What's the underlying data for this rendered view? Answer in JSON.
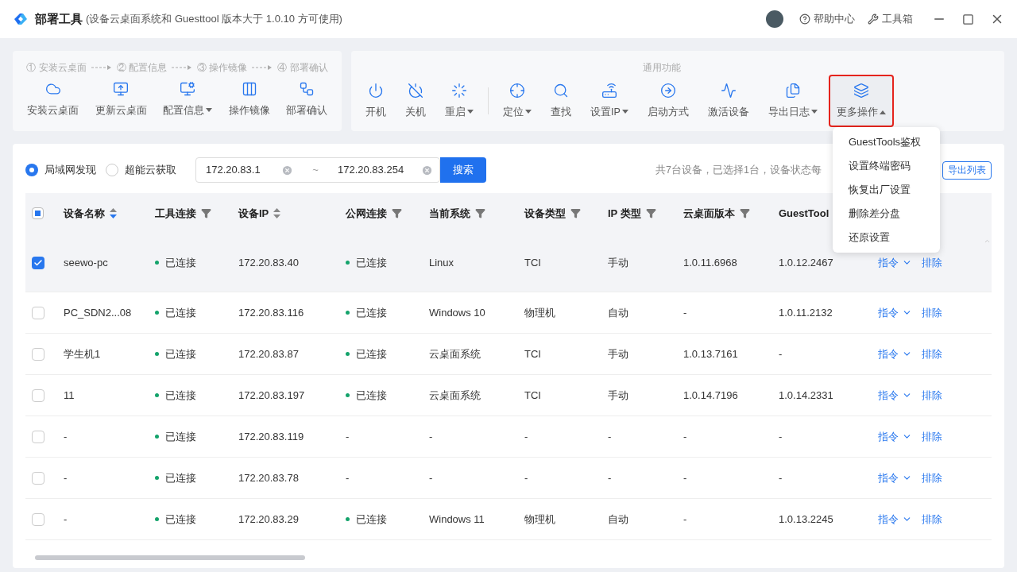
{
  "window": {
    "title": "部署工具",
    "subtitle": "(设备云桌面系统和 Guesttool 版本大于 1.0.10 方可使用)",
    "links": [
      "帮助中心",
      "工具箱"
    ]
  },
  "workflow": {
    "steps": [
      "① 安装云桌面",
      "② 配置信息",
      "③ 操作镜像",
      "④ 部署确认"
    ],
    "buttons": [
      {
        "label": "安装云桌面",
        "dropdown": false
      },
      {
        "label": "更新云桌面",
        "dropdown": false
      },
      {
        "label": "配置信息",
        "dropdown": true
      },
      {
        "label": "操作镜像",
        "dropdown": false
      },
      {
        "label": "部署确认",
        "dropdown": false
      }
    ]
  },
  "general": {
    "title": "通用功能",
    "groups": [
      [
        {
          "label": "开机",
          "dropdown": false
        },
        {
          "label": "关机",
          "dropdown": false
        },
        {
          "label": "重启",
          "dropdown": true,
          "expanded": false,
          "highlighted": false
        }
      ],
      [
        {
          "label": "定位",
          "dropdown": true,
          "expanded": false,
          "highlighted": false
        },
        {
          "label": "查找",
          "dropdown": false
        },
        {
          "label": "设置IP",
          "dropdown": true,
          "expanded": false,
          "highlighted": false
        },
        {
          "label": "启动方式",
          "dropdown": false
        },
        {
          "label": "激活设备",
          "dropdown": false
        },
        {
          "label": "导出日志",
          "dropdown": true,
          "expanded": false,
          "highlighted": false
        },
        {
          "label": "更多操作",
          "dropdown": true,
          "expanded": true,
          "highlighted": true
        }
      ]
    ]
  },
  "menu": {
    "items": [
      "GuestTools鉴权",
      "设置终端密码",
      "恢复出厂设置",
      "删除差分盘",
      "还原设置"
    ]
  },
  "discovery": {
    "modes": [
      {
        "label": "局域网发现",
        "selected": true
      },
      {
        "label": "超能云获取",
        "selected": false
      }
    ],
    "ip_from": "172.20.83.1",
    "separator": "~",
    "ip_to": "172.20.83.254",
    "search_button": "搜索",
    "summary": "共7台设备，已选择1台，设备状态每",
    "export_button": "导出列表"
  },
  "table": {
    "select_all_indeterminate": true,
    "columns": [
      {
        "label": "设备名称",
        "kind": "sort",
        "sorted_descending": true
      },
      {
        "label": "工具连接",
        "kind": "filter"
      },
      {
        "label": "设备IP",
        "kind": "sort",
        "sorted_descending": false
      },
      {
        "label": "公网连接",
        "kind": "filter"
      },
      {
        "label": "当前系统",
        "kind": "filter"
      },
      {
        "label": "设备类型",
        "kind": "filter"
      },
      {
        "label": "IP 类型",
        "kind": "filter"
      },
      {
        "label": "云桌面版本",
        "kind": "filter"
      },
      {
        "label": "GuestTool",
        "kind": "plain"
      }
    ],
    "rows": [
      {
        "checked": true,
        "cells": [
          {
            "text": "seewo-pc",
            "connected": false
          },
          {
            "text": "已连接",
            "connected": true
          },
          {
            "text": "172.20.83.40",
            "connected": false
          },
          {
            "text": "已连接",
            "connected": true
          },
          {
            "text": "Linux",
            "connected": false
          },
          {
            "text": "TCI",
            "connected": false
          },
          {
            "text": "手动",
            "connected": false
          },
          {
            "text": "1.0.11.6968",
            "connected": false
          },
          {
            "text": "1.0.12.2467",
            "connected": false
          }
        ],
        "actions": [
          "指令",
          "排除"
        ]
      },
      {
        "checked": false,
        "cells": [
          {
            "text": "PC_SDN2...08",
            "connected": false
          },
          {
            "text": "已连接",
            "connected": true
          },
          {
            "text": "172.20.83.116",
            "connected": false
          },
          {
            "text": "已连接",
            "connected": true
          },
          {
            "text": "Windows 10",
            "connected": false
          },
          {
            "text": "物理机",
            "connected": false
          },
          {
            "text": "自动",
            "connected": false
          },
          {
            "text": "-",
            "connected": false
          },
          {
            "text": "1.0.11.2132",
            "connected": false
          }
        ],
        "actions": [
          "指令",
          "排除"
        ]
      },
      {
        "checked": false,
        "cells": [
          {
            "text": "学生机1",
            "connected": false
          },
          {
            "text": "已连接",
            "connected": true
          },
          {
            "text": "172.20.83.87",
            "connected": false
          },
          {
            "text": "已连接",
            "connected": true
          },
          {
            "text": "云桌面系统",
            "connected": false
          },
          {
            "text": "TCI",
            "connected": false
          },
          {
            "text": "手动",
            "connected": false
          },
          {
            "text": "1.0.13.7161",
            "connected": false
          },
          {
            "text": "-",
            "connected": false
          }
        ],
        "actions": [
          "指令",
          "排除"
        ]
      },
      {
        "checked": false,
        "cells": [
          {
            "text": "11",
            "connected": false
          },
          {
            "text": "已连接",
            "connected": true
          },
          {
            "text": "172.20.83.197",
            "connected": false
          },
          {
            "text": "已连接",
            "connected": true
          },
          {
            "text": "云桌面系统",
            "connected": false
          },
          {
            "text": "TCI",
            "connected": false
          },
          {
            "text": "手动",
            "connected": false
          },
          {
            "text": "1.0.14.7196",
            "connected": false
          },
          {
            "text": "1.0.14.2331",
            "connected": false
          }
        ],
        "actions": [
          "指令",
          "排除"
        ]
      },
      {
        "checked": false,
        "cells": [
          {
            "text": "-",
            "connected": false
          },
          {
            "text": "已连接",
            "connected": true
          },
          {
            "text": "172.20.83.119",
            "connected": false
          },
          {
            "text": "-",
            "connected": false
          },
          {
            "text": "-",
            "connected": false
          },
          {
            "text": "-",
            "connected": false
          },
          {
            "text": "-",
            "connected": false
          },
          {
            "text": "-",
            "connected": false
          },
          {
            "text": "-",
            "connected": false
          }
        ],
        "actions": [
          "指令",
          "排除"
        ]
      },
      {
        "checked": false,
        "cells": [
          {
            "text": "-",
            "connected": false
          },
          {
            "text": "已连接",
            "connected": true
          },
          {
            "text": "172.20.83.78",
            "connected": false
          },
          {
            "text": "-",
            "connected": false
          },
          {
            "text": "-",
            "connected": false
          },
          {
            "text": "-",
            "connected": false
          },
          {
            "text": "-",
            "connected": false
          },
          {
            "text": "-",
            "connected": false
          },
          {
            "text": "-",
            "connected": false
          }
        ],
        "actions": [
          "指令",
          "排除"
        ]
      },
      {
        "checked": false,
        "cells": [
          {
            "text": "-",
            "connected": false
          },
          {
            "text": "已连接",
            "connected": true
          },
          {
            "text": "172.20.83.29",
            "connected": false
          },
          {
            "text": "已连接",
            "connected": true
          },
          {
            "text": "Windows 11",
            "connected": false
          },
          {
            "text": "物理机",
            "connected": false
          },
          {
            "text": "自动",
            "connected": false
          },
          {
            "text": "-",
            "connected": false
          },
          {
            "text": "1.0.13.2245",
            "connected": false
          }
        ],
        "actions": [
          "指令",
          "排除"
        ]
      }
    ]
  }
}
